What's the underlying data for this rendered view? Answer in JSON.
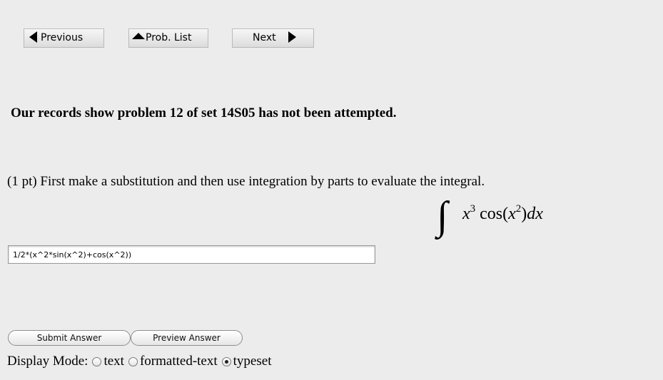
{
  "nav": {
    "previous_label": "Previous",
    "prob_list_label": "Prob. List",
    "next_label": "Next"
  },
  "status_message": "Our records show problem 12 of set 14S05 has not been attempted.",
  "problem": {
    "text": "(1 pt) First make a substitution and then use integration by parts to evaluate the integral.",
    "formula_latex": "\\int x^3 \\cos(x^2)dx"
  },
  "answer": {
    "value": "1/2*(x^2*sin(x^2)+cos(x^2))"
  },
  "buttons": {
    "submit_label": "Submit Answer",
    "preview_label": "Preview Answer"
  },
  "display_mode": {
    "label": "Display Mode:",
    "options": [
      {
        "label": "text",
        "selected": false
      },
      {
        "label": "formatted-text",
        "selected": false
      },
      {
        "label": "typeset",
        "selected": true
      }
    ]
  }
}
